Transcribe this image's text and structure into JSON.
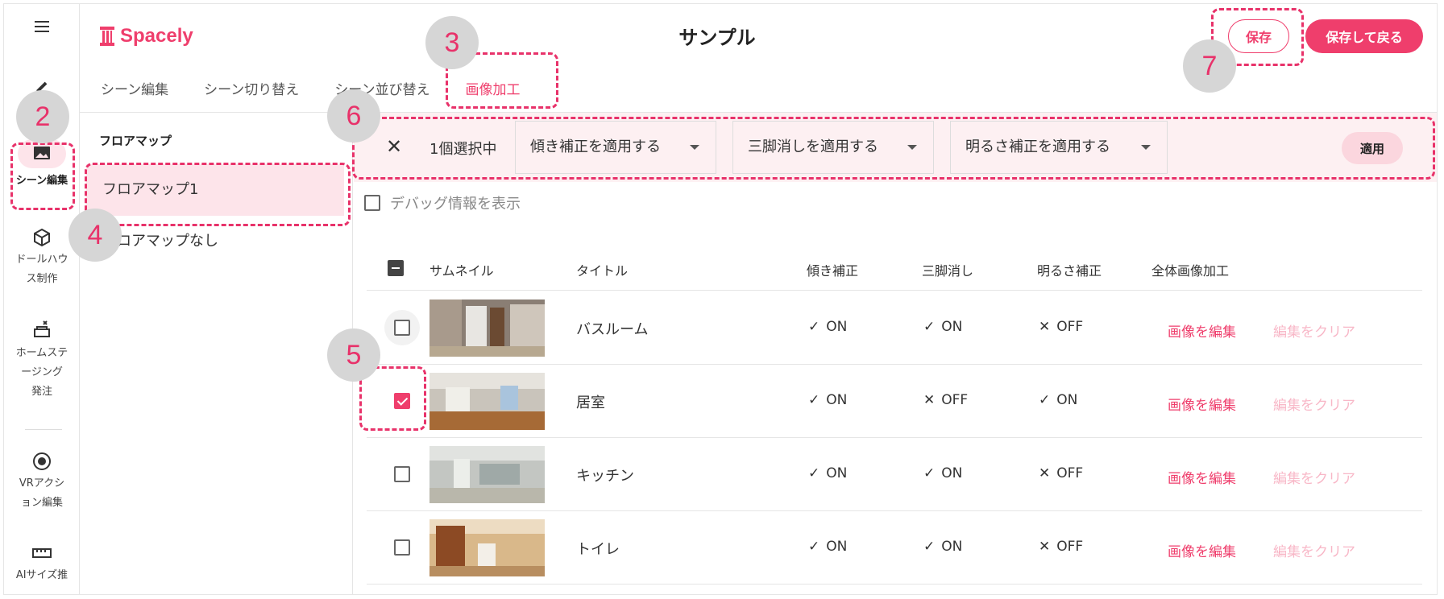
{
  "app": {
    "logo_text": "Spacely",
    "page_title": "サンプル",
    "save_label": "保存",
    "save_back_label": "保存して戻る"
  },
  "rail": {
    "items": [
      {
        "label": "シーン編集",
        "icon": "image-icon"
      },
      {
        "label": "ドールハウス制作",
        "line1": "ドールハウ",
        "line2": "ス制作",
        "icon": "cube-icon"
      },
      {
        "label": "ホームステージング発注",
        "line1": "ホームステ",
        "line2": "ージング",
        "line3": "発注",
        "icon": "sofa-icon"
      },
      {
        "label": "VRアクション編集",
        "line1": "VRアクシ",
        "line2": "ョン編集",
        "icon": "target-icon"
      },
      {
        "label": "AIサイズ推",
        "icon": "ruler-icon"
      }
    ]
  },
  "tabs": [
    {
      "label": "シーン編集"
    },
    {
      "label": "シーン切り替え"
    },
    {
      "label": "シーン並び替え"
    },
    {
      "label": "画像加工",
      "active": true
    }
  ],
  "floor_maps": {
    "heading": "フロアマップ",
    "items": [
      {
        "label": "フロアマップ1",
        "active": true
      },
      {
        "label": "フロアマップなし"
      }
    ]
  },
  "action_bar": {
    "selection_text": "1個選択中",
    "tilt_select": "傾き補正を適用する",
    "tripod_select": "三脚消しを適用する",
    "brightness_select": "明るさ補正を適用する",
    "apply_label": "適用"
  },
  "debug_label": "デバッグ情報を表示",
  "table": {
    "headers": {
      "thumbnail": "サムネイル",
      "title": "タイトル",
      "tilt": "傾き補正",
      "tripod": "三脚消し",
      "brightness": "明るさ補正",
      "whole": "全体画像加工"
    },
    "edit_label": "画像を編集",
    "clear_label": "編集をクリア",
    "rows": [
      {
        "title": "バスルーム",
        "checked": false,
        "tilt": "ON",
        "tripod": "ON",
        "brightness": "OFF"
      },
      {
        "title": "居室",
        "checked": true,
        "tilt": "ON",
        "tripod": "OFF",
        "brightness": "ON"
      },
      {
        "title": "キッチン",
        "checked": false,
        "tilt": "ON",
        "tripod": "ON",
        "brightness": "OFF"
      },
      {
        "title": "トイレ",
        "checked": false,
        "tilt": "ON",
        "tripod": "ON",
        "brightness": "OFF"
      }
    ]
  },
  "annotations": [
    "2",
    "3",
    "4",
    "5",
    "6",
    "7"
  ],
  "colors": {
    "accent": "#ef3e6c",
    "annotation": "#e8326a",
    "active_bg": "#fde4ea",
    "action_bar_bg": "#fdf0f2"
  }
}
